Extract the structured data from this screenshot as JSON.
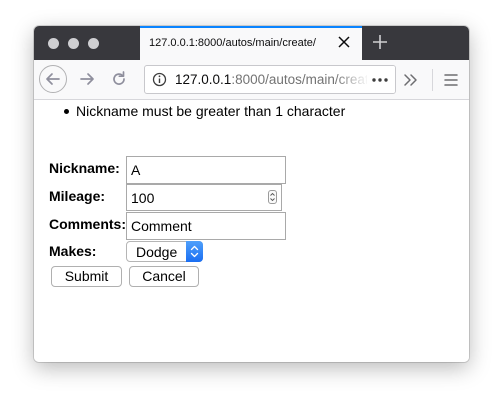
{
  "browser": {
    "tab_title": "127.0.0.1:8000/autos/main/create/",
    "url_host": "127.0.0.1",
    "url_path": ":8000/autos/main/create/"
  },
  "form": {
    "errors": [
      "Nickname must be greater than 1 character"
    ],
    "nickname": {
      "label": "Nickname:",
      "value": "A"
    },
    "mileage": {
      "label": "Mileage:",
      "value": "100"
    },
    "comments": {
      "label": "Comments:",
      "value": "Comment"
    },
    "makes": {
      "label": "Makes:",
      "selected": "Dodge"
    },
    "submit_label": "Submit",
    "cancel_label": "Cancel"
  },
  "colors": {
    "tabbar": "#38383d",
    "tab_accent": "#0a84ff",
    "select_accent": "#1a6ef2"
  }
}
